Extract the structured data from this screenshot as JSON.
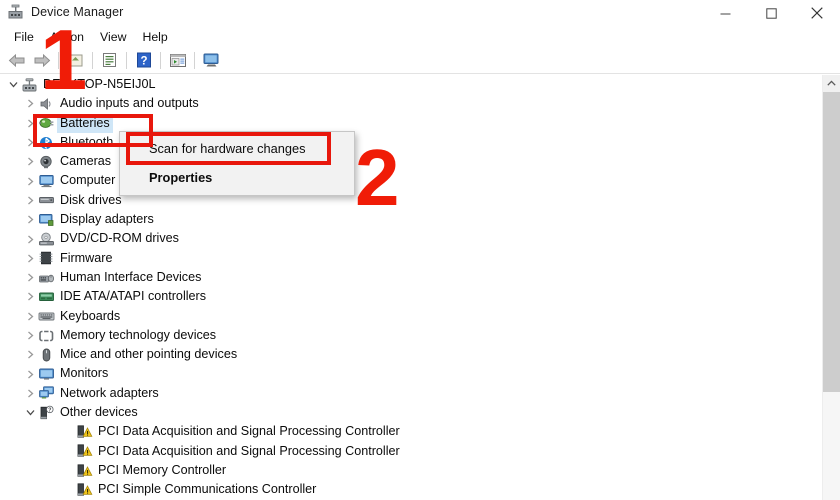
{
  "window": {
    "title": "Device Manager",
    "icon": "device-manager-icon",
    "controls": {
      "minimize": "—",
      "maximize": "☐",
      "close": "✕"
    }
  },
  "menubar": {
    "items": [
      "File",
      "Action",
      "View",
      "Help"
    ]
  },
  "toolbar": {
    "items": [
      {
        "name": "back-icon",
        "label": "Back"
      },
      {
        "name": "forward-icon",
        "label": "Forward"
      },
      {
        "name": "up-icon",
        "label": "Up"
      },
      {
        "name": "properties-icon",
        "label": "Properties"
      },
      {
        "name": "help-icon",
        "label": "Help"
      },
      {
        "name": "scan-hardware-icon",
        "label": "Scan for hardware changes"
      },
      {
        "name": "show-hidden-devices-icon",
        "label": "Display"
      }
    ]
  },
  "tree": {
    "root": {
      "label": "DESKTOP-N5EIJ0L",
      "icon": "computer-icon",
      "expanded": true
    },
    "items": [
      {
        "label": "Audio inputs and outputs",
        "icon": "audio-icon",
        "expandable": true,
        "selected": false
      },
      {
        "label": "Batteries",
        "icon": "battery-icon",
        "expandable": true,
        "selected": true
      },
      {
        "label": "Bluetooth",
        "icon": "bluetooth-icon",
        "expandable": true,
        "selected": false
      },
      {
        "label": "Cameras",
        "icon": "camera-icon",
        "expandable": true,
        "selected": false
      },
      {
        "label": "Computer",
        "icon": "computer-monitor-icon",
        "expandable": true,
        "selected": false
      },
      {
        "label": "Disk drives",
        "icon": "disk-icon",
        "expandable": true,
        "selected": false
      },
      {
        "label": "Display adapters",
        "icon": "display-adapter-icon",
        "expandable": true,
        "selected": false
      },
      {
        "label": "DVD/CD-ROM drives",
        "icon": "dvd-icon",
        "expandable": true,
        "selected": false
      },
      {
        "label": "Firmware",
        "icon": "firmware-icon",
        "expandable": true,
        "selected": false
      },
      {
        "label": "Human Interface Devices",
        "icon": "hid-icon",
        "expandable": true,
        "selected": false
      },
      {
        "label": "IDE ATA/ATAPI controllers",
        "icon": "ide-icon",
        "expandable": true,
        "selected": false
      },
      {
        "label": "Keyboards",
        "icon": "keyboard-icon",
        "expandable": true,
        "selected": false
      },
      {
        "label": "Memory technology devices",
        "icon": "memory-icon",
        "expandable": true,
        "selected": false
      },
      {
        "label": "Mice and other pointing devices",
        "icon": "mouse-icon",
        "expandable": true,
        "selected": false
      },
      {
        "label": "Monitors",
        "icon": "monitor-icon",
        "expandable": true,
        "selected": false
      },
      {
        "label": "Network adapters",
        "icon": "network-icon",
        "expandable": true,
        "selected": false
      },
      {
        "label": "Other devices",
        "icon": "other-device-icon",
        "expandable": true,
        "expanded": true,
        "selected": false
      }
    ],
    "other_devices_children": [
      {
        "label": "PCI Data Acquisition and Signal Processing Controller",
        "icon": "warning-device-icon"
      },
      {
        "label": "PCI Data Acquisition and Signal Processing Controller",
        "icon": "warning-device-icon"
      },
      {
        "label": "PCI Memory Controller",
        "icon": "warning-device-icon"
      },
      {
        "label": "PCI Simple Communications Controller",
        "icon": "warning-device-icon"
      }
    ]
  },
  "context_menu": {
    "items": [
      {
        "label": "Scan for hardware changes",
        "bold": false
      },
      {
        "label": "Properties",
        "bold": true
      }
    ]
  },
  "annotations": {
    "step1": "1",
    "step2": "2",
    "color": "#e8170c"
  }
}
